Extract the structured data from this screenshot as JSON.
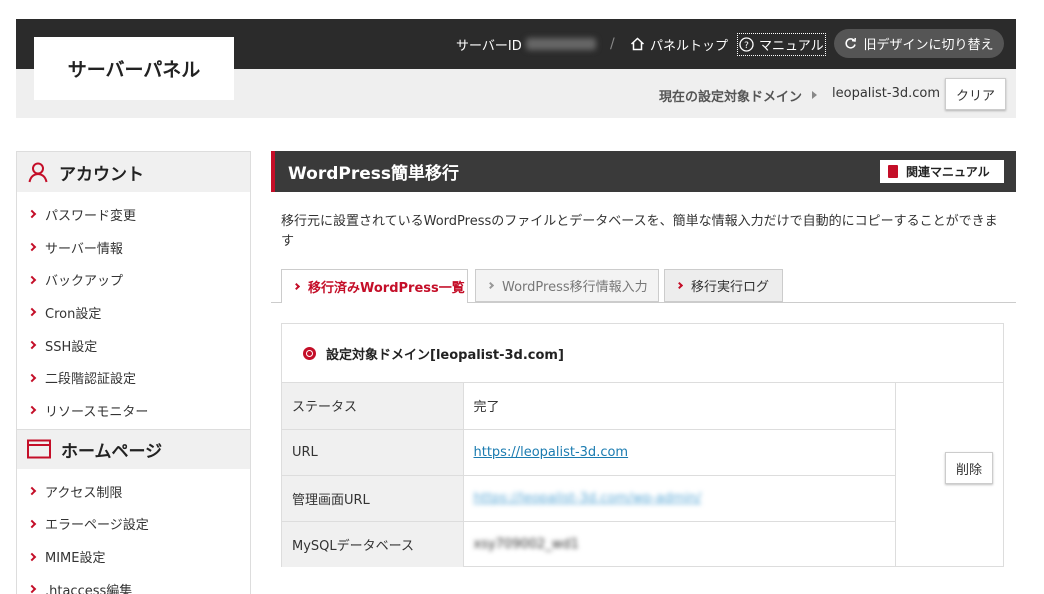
{
  "header": {
    "logo": "サーバーパネル",
    "server_id_label": "サーバーID",
    "separator": "/",
    "panel_top": "パネルトップ",
    "manual": "マニュアル",
    "old_design": "旧デザインに切り替え",
    "domain_label": "現在の設定対象ドメイン",
    "domain_value": "leopalist-3d.com",
    "clear": "クリア"
  },
  "sidebar": {
    "account_title": "アカウント",
    "account_items": [
      {
        "label": "パスワード変更"
      },
      {
        "label": "サーバー情報"
      },
      {
        "label": "バックアップ"
      },
      {
        "label": "Cron設定"
      },
      {
        "label": "SSH設定"
      },
      {
        "label": "二段階認証設定"
      },
      {
        "label": "リソースモニター"
      }
    ],
    "homepage_title": "ホームページ",
    "homepage_items": [
      {
        "label": "アクセス制限"
      },
      {
        "label": "エラーページ設定"
      },
      {
        "label": "MIME設定"
      },
      {
        "label": ".htaccess編集"
      }
    ]
  },
  "main": {
    "title": "WordPress簡単移行",
    "related_manual": "関連マニュアル",
    "description": "移行元に設置されているWordPressのファイルとデータベースを、簡単な情報入力だけで自動的にコピーすることができます",
    "tabs": [
      {
        "label": "移行済みWordPress一覧"
      },
      {
        "label": "WordPress移行情報入力"
      },
      {
        "label": "移行実行ログ"
      }
    ],
    "panel": {
      "heading": "設定対象ドメイン[leopalist-3d.com]",
      "rows": [
        {
          "key": "ステータス",
          "value": "完了"
        },
        {
          "key": "URL",
          "value": "https://leopalist-3d.com"
        },
        {
          "key": "管理画面URL",
          "value": "https://leopalist-3d.com/wp-admin/"
        },
        {
          "key": "MySQLデータベース",
          "value": "xsy709002_wd1"
        }
      ],
      "delete": "削除"
    }
  },
  "colors": {
    "accent": "#c40e28",
    "header_dark": "#2b2b2b",
    "link": "#1a7bb0"
  }
}
